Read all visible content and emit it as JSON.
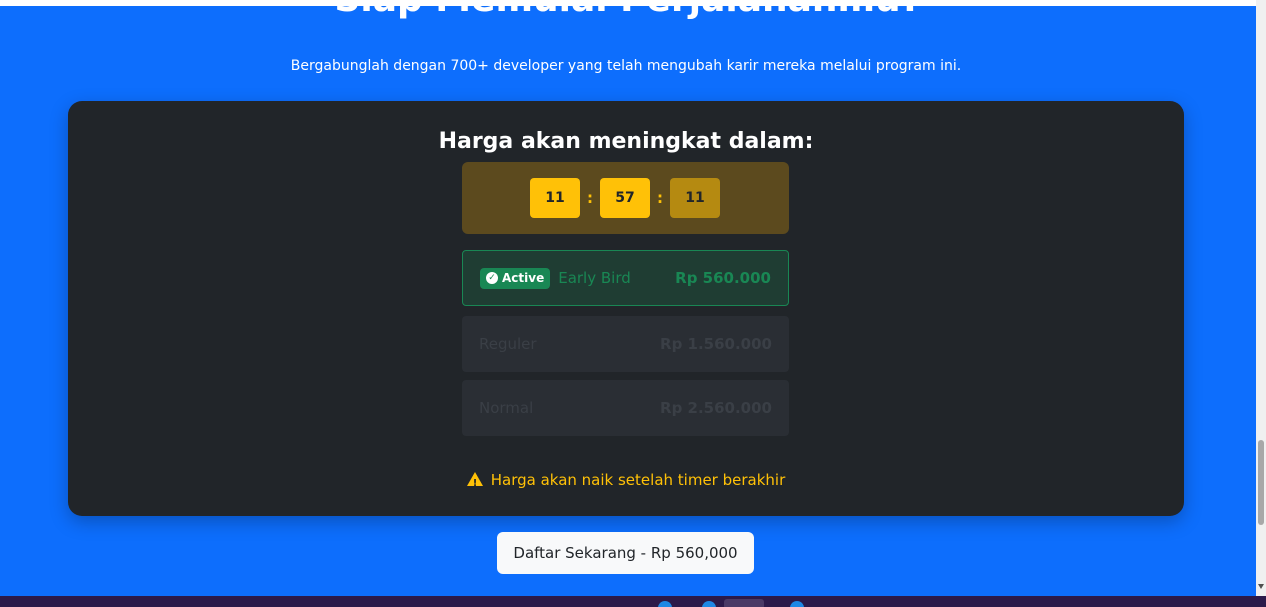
{
  "hero": {
    "title": "Siap Memulai Perjalananmu?",
    "subtitle": "Bergabunglah dengan 700+ developer yang telah mengubah karir mereka melalui program ini."
  },
  "pricing_card": {
    "heading": "Harga akan meningkat dalam:",
    "timer": {
      "hours": "11",
      "minutes": "57",
      "seconds": "11",
      "separator": ":"
    },
    "tiers": [
      {
        "badge": "Active",
        "name": "Early Bird",
        "price": "Rp 560.000",
        "active": true
      },
      {
        "name": "Reguler",
        "price": "Rp 1.560.000",
        "active": false
      },
      {
        "name": "Normal",
        "price": "Rp 2.560.000",
        "active": false
      }
    ],
    "warning": "Harga akan naik setelah timer berakhir",
    "warning_icon": "warning-triangle-icon"
  },
  "cta": {
    "label": "Daftar Sekarang - Rp 560,000"
  },
  "colors": {
    "page_bg": "#0d6efd",
    "card_bg": "#212529",
    "timer_accent": "#ffc107",
    "active_green": "#198754",
    "button_bg": "#f8f9fa"
  }
}
